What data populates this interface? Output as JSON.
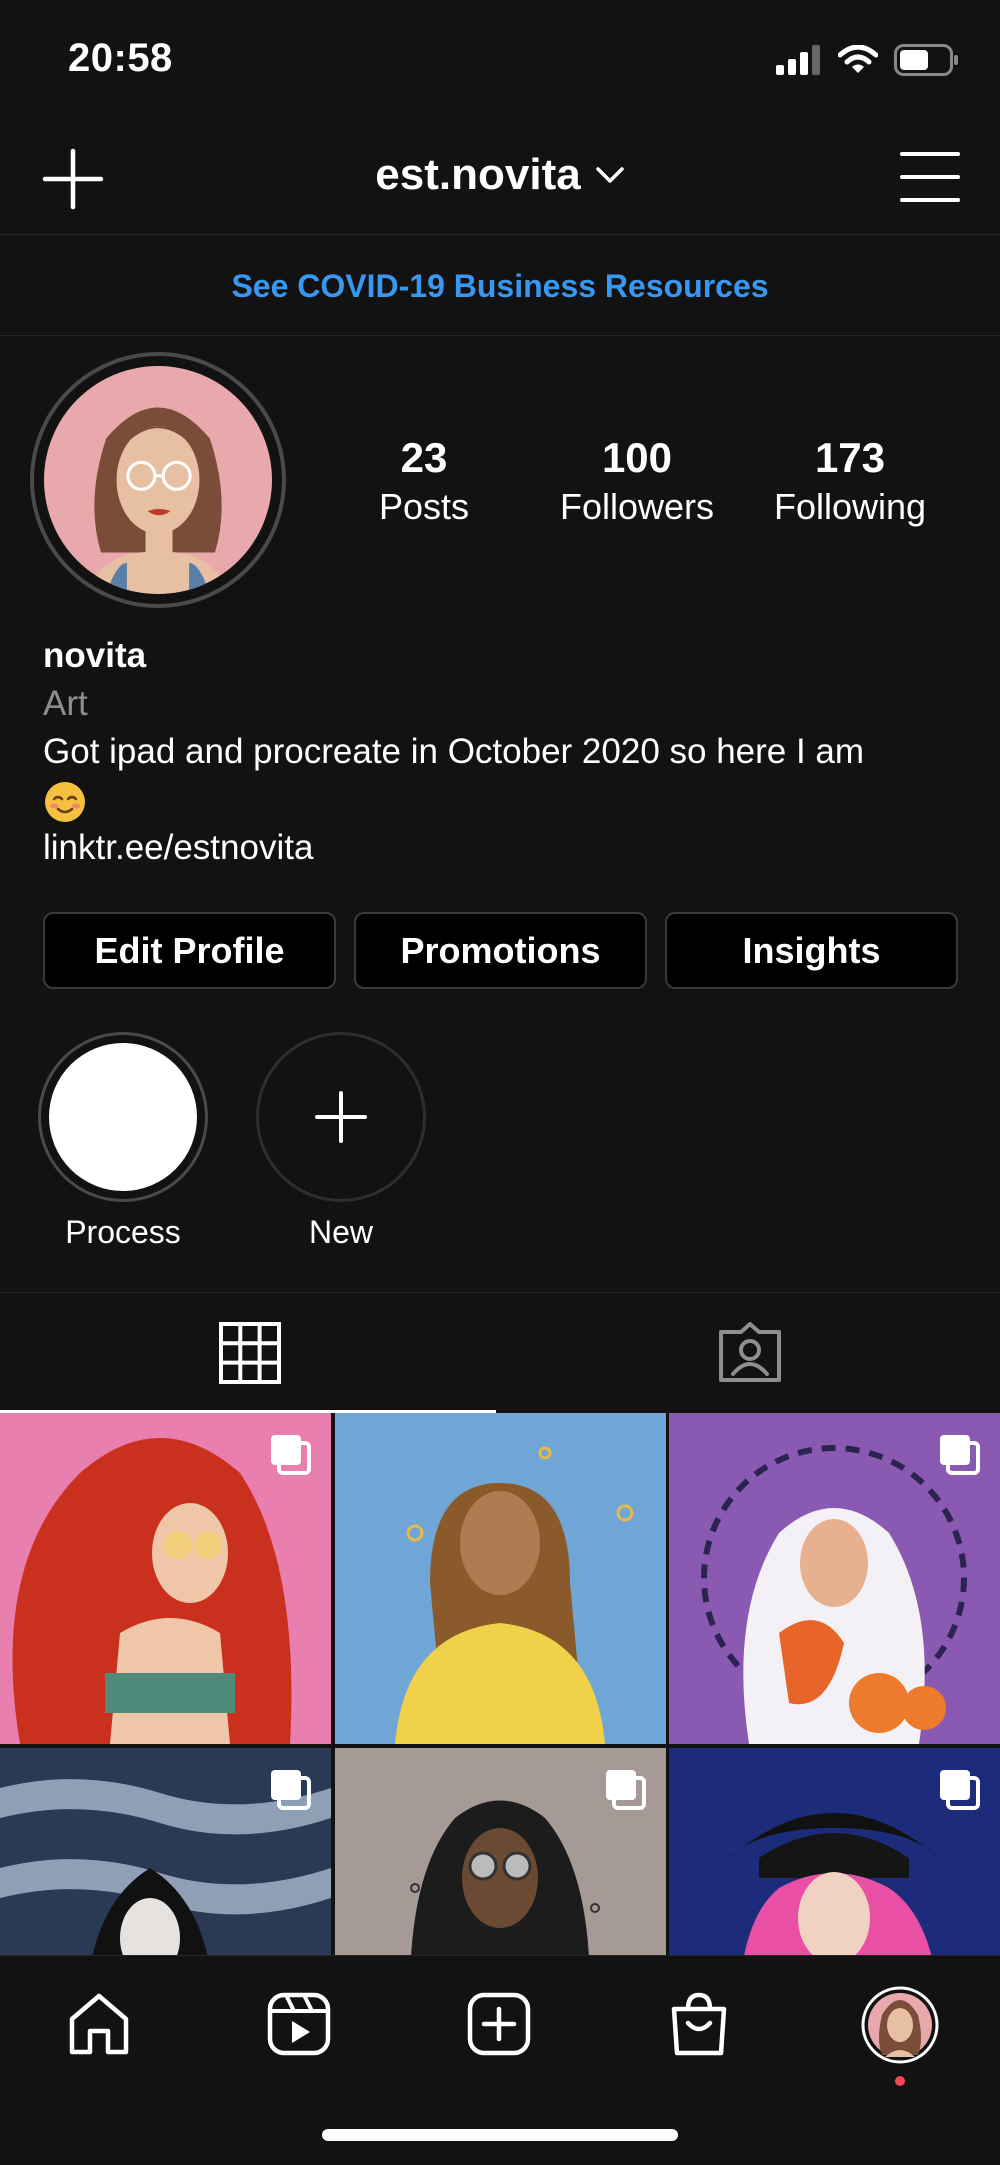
{
  "status": {
    "time": "20:58"
  },
  "header": {
    "username": "est.novita",
    "icons": [
      "plus-icon",
      "chevron-down-icon",
      "hamburger-menu-icon"
    ]
  },
  "banner": {
    "text": "See COVID-19 Business Resources"
  },
  "profile": {
    "stats": [
      {
        "value": "23",
        "label": "Posts"
      },
      {
        "value": "100",
        "label": "Followers"
      },
      {
        "value": "173",
        "label": "Following"
      }
    ],
    "name": "novita",
    "category": "Art",
    "bio": "Got ipad and procreate in October 2020 so here I am",
    "link": "linktr.ee/estnovita"
  },
  "buttons": {
    "edit": "Edit Profile",
    "promotions": "Promotions",
    "insights": "Insights"
  },
  "highlights": [
    {
      "label": "Process"
    },
    {
      "label": "New"
    }
  ],
  "tabs": [
    "grid-icon",
    "tagged-icon"
  ],
  "posts": [
    {
      "bg": "#e97fae",
      "multi": true
    },
    {
      "bg": "#6fa6d6",
      "multi": false
    },
    {
      "bg": "#8a5ab3",
      "multi": true
    },
    {
      "bg": "#2a3a55",
      "multi": true
    },
    {
      "bg": "#a59a95",
      "multi": true
    },
    {
      "bg": "#1d2c7a",
      "multi": true
    }
  ],
  "colors": {
    "background": "#121212",
    "link": "#3897f0",
    "muted": "#8e8e8e",
    "notification": "#ed4956"
  }
}
